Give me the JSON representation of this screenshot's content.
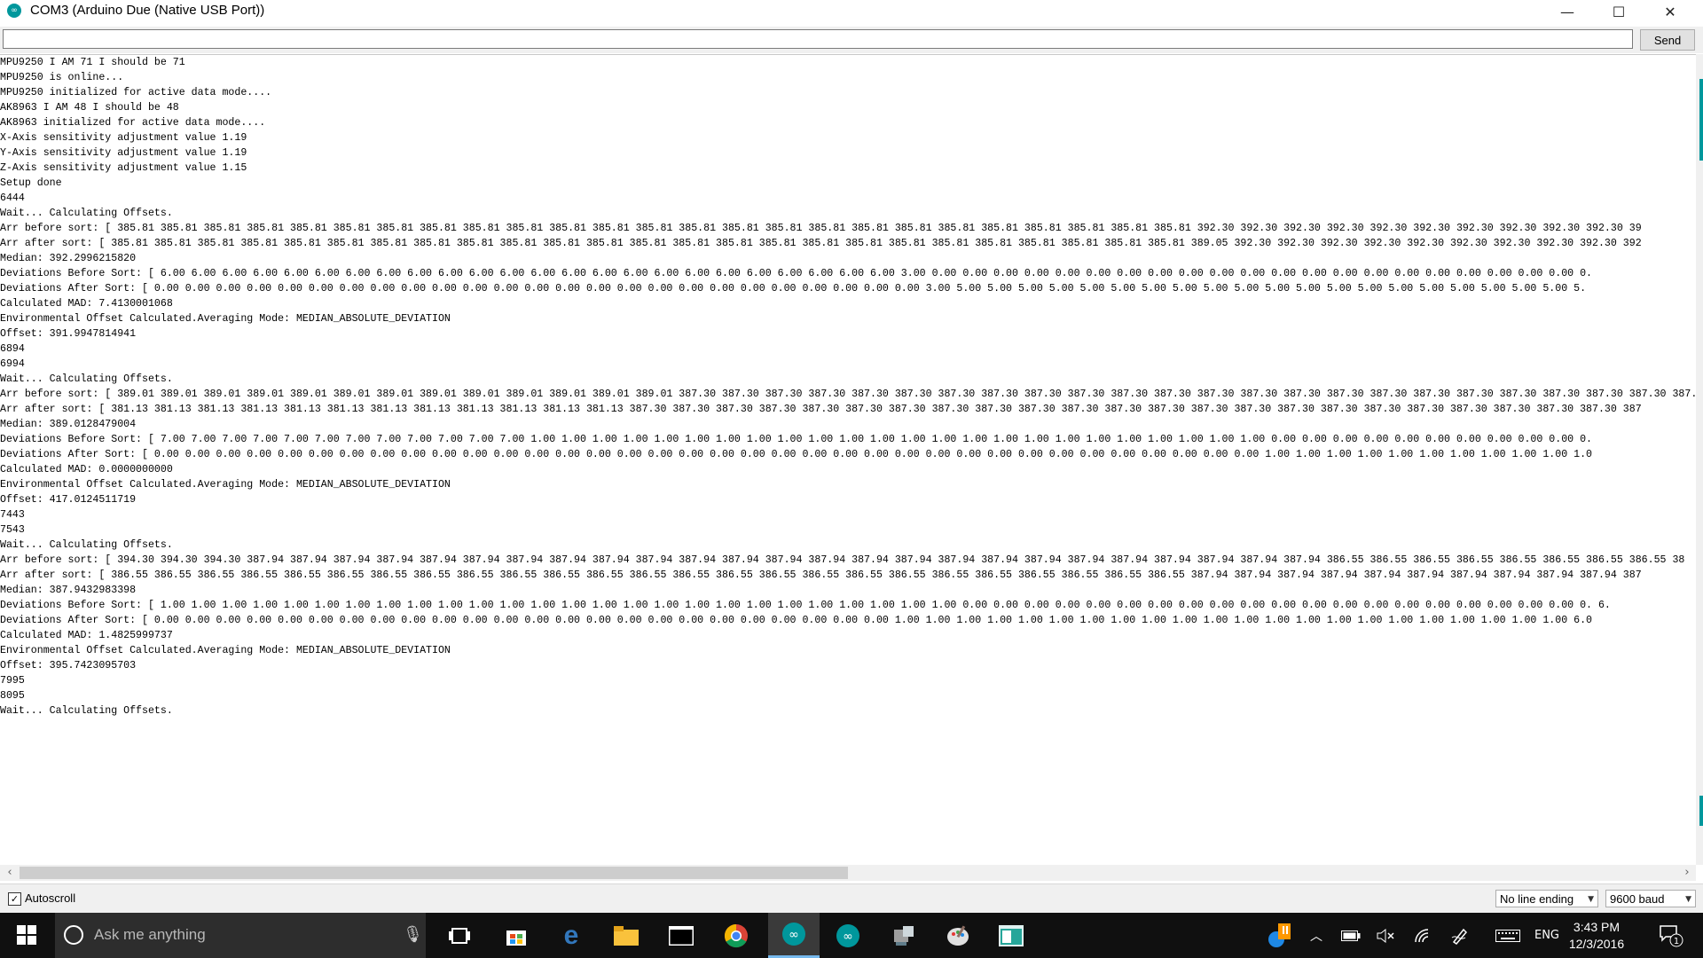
{
  "window": {
    "title": "COM3 (Arduino Due (Native USB Port))",
    "app_icon": "arduino-icon",
    "controls": [
      "minimize-icon",
      "maximize-icon",
      "close-icon"
    ]
  },
  "input_bar": {
    "value": "",
    "send_label": "Send"
  },
  "serial_output": [
    "MPU9250 I AM 71 I should be 71",
    "MPU9250 is online...",
    "MPU9250 initialized for active data mode....",
    "AK8963 I AM 48 I should be 48",
    "AK8963 initialized for active data mode....",
    "X-Axis sensitivity adjustment value 1.19",
    "Y-Axis sensitivity adjustment value 1.19",
    "Z-Axis sensitivity adjustment value 1.15",
    "Setup done",
    "6444",
    "Wait... Calculating Offsets.",
    "Arr before sort: [ 385.81 385.81 385.81 385.81 385.81 385.81 385.81 385.81 385.81 385.81 385.81 385.81 385.81 385.81 385.81 385.81 385.81 385.81 385.81 385.81 385.81 385.81 385.81 385.81 385.81 392.30 392.30 392.30 392.30 392.30 392.30 392.30 392.30 392.30 392.30 39",
    "Arr after sort: [ 385.81 385.81 385.81 385.81 385.81 385.81 385.81 385.81 385.81 385.81 385.81 385.81 385.81 385.81 385.81 385.81 385.81 385.81 385.81 385.81 385.81 385.81 385.81 385.81 385.81 389.05 392.30 392.30 392.30 392.30 392.30 392.30 392.30 392.30 392.30 392",
    "Median: 392.2996215820",
    "Deviations Before Sort: [ 6.00 6.00 6.00 6.00 6.00 6.00 6.00 6.00 6.00 6.00 6.00 6.00 6.00 6.00 6.00 6.00 6.00 6.00 6.00 6.00 6.00 6.00 6.00 6.00 3.00 0.00 0.00 0.00 0.00 0.00 0.00 0.00 0.00 0.00 0.00 0.00 0.00 0.00 0.00 0.00 0.00 0.00 0.00 0.00 0.00 0.00 0.",
    "Deviations After Sort: [ 0.00 0.00 0.00 0.00 0.00 0.00 0.00 0.00 0.00 0.00 0.00 0.00 0.00 0.00 0.00 0.00 0.00 0.00 0.00 0.00 0.00 0.00 0.00 0.00 0.00 3.00 5.00 5.00 5.00 5.00 5.00 5.00 5.00 5.00 5.00 5.00 5.00 5.00 5.00 5.00 5.00 5.00 5.00 5.00 5.00 5.00 5.",
    "Calculated MAD: 7.4130001068",
    "Environmental Offset Calculated.Averaging Mode: MEDIAN_ABSOLUTE_DEVIATION",
    "Offset: 391.9947814941",
    "6894",
    "6994",
    "Wait... Calculating Offsets.",
    "Arr before sort: [ 389.01 389.01 389.01 389.01 389.01 389.01 389.01 389.01 389.01 389.01 389.01 389.01 389.01 387.30 387.30 387.30 387.30 387.30 387.30 387.30 387.30 387.30 387.30 387.30 387.30 387.30 387.30 387.30 387.30 387.30 387.30 387.30 387.30 387.30 387.30 387.30 387.30",
    "Arr after sort: [ 381.13 381.13 381.13 381.13 381.13 381.13 381.13 381.13 381.13 381.13 381.13 381.13 387.30 387.30 387.30 387.30 387.30 387.30 387.30 387.30 387.30 387.30 387.30 387.30 387.30 387.30 387.30 387.30 387.30 387.30 387.30 387.30 387.30 387.30 387.30 387",
    "Median: 389.0128479004",
    "Deviations Before Sort: [ 7.00 7.00 7.00 7.00 7.00 7.00 7.00 7.00 7.00 7.00 7.00 7.00 1.00 1.00 1.00 1.00 1.00 1.00 1.00 1.00 1.00 1.00 1.00 1.00 1.00 1.00 1.00 1.00 1.00 1.00 1.00 1.00 1.00 1.00 1.00 1.00 0.00 0.00 0.00 0.00 0.00 0.00 0.00 0.00 0.00 0.00 0.",
    "Deviations After Sort: [ 0.00 0.00 0.00 0.00 0.00 0.00 0.00 0.00 0.00 0.00 0.00 0.00 0.00 0.00 0.00 0.00 0.00 0.00 0.00 0.00 0.00 0.00 0.00 0.00 0.00 0.00 0.00 0.00 0.00 0.00 0.00 0.00 0.00 0.00 0.00 0.00 1.00 1.00 1.00 1.00 1.00 1.00 1.00 1.00 1.00 1.00 1.0",
    "Calculated MAD: 0.0000000000",
    "Environmental Offset Calculated.Averaging Mode: MEDIAN_ABSOLUTE_DEVIATION",
    "Offset: 417.0124511719",
    "7443",
    "7543",
    "Wait... Calculating Offsets.",
    "Arr before sort: [ 394.30 394.30 394.30 387.94 387.94 387.94 387.94 387.94 387.94 387.94 387.94 387.94 387.94 387.94 387.94 387.94 387.94 387.94 387.94 387.94 387.94 387.94 387.94 387.94 387.94 387.94 387.94 387.94 386.55 386.55 386.55 386.55 386.55 386.55 386.55 386.55 38",
    "Arr after sort: [ 386.55 386.55 386.55 386.55 386.55 386.55 386.55 386.55 386.55 386.55 386.55 386.55 386.55 386.55 386.55 386.55 386.55 386.55 386.55 386.55 386.55 386.55 386.55 386.55 386.55 387.94 387.94 387.94 387.94 387.94 387.94 387.94 387.94 387.94 387.94 387",
    "Median: 387.9432983398",
    "Deviations Before Sort: [ 1.00 1.00 1.00 1.00 1.00 1.00 1.00 1.00 1.00 1.00 1.00 1.00 1.00 1.00 1.00 1.00 1.00 1.00 1.00 1.00 1.00 1.00 1.00 1.00 1.00 1.00 0.00 0.00 0.00 0.00 0.00 0.00 0.00 0.00 0.00 0.00 0.00 0.00 0.00 0.00 0.00 0.00 0.00 0.00 0.00 0.00 0. 6.",
    "Deviations After Sort: [ 0.00 0.00 0.00 0.00 0.00 0.00 0.00 0.00 0.00 0.00 0.00 0.00 0.00 0.00 0.00 0.00 0.00 0.00 0.00 0.00 0.00 0.00 0.00 0.00 1.00 1.00 1.00 1.00 1.00 1.00 1.00 1.00 1.00 1.00 1.00 1.00 1.00 1.00 1.00 1.00 1.00 1.00 1.00 1.00 1.00 1.00 6.0",
    "Calculated MAD: 1.4825999737",
    "Environmental Offset Calculated.Averaging Mode: MEDIAN_ABSOLUTE_DEVIATION",
    "Offset: 395.7423095703",
    "7995",
    "8095",
    "Wait... Calculating Offsets."
  ],
  "status_bar": {
    "autoscroll_label": "Autoscroll",
    "autoscroll_checked": true,
    "line_ending": "No line ending",
    "baud": "9600 baud"
  },
  "taskbar": {
    "search_placeholder": "Ask me anything",
    "language": "ENG",
    "time": "3:43 PM",
    "date": "12/3/2016",
    "notification_count": "1"
  },
  "colors": {
    "accent": "#00979c",
    "taskbar": "#101010",
    "tray_highlight": "#76b9ed"
  }
}
